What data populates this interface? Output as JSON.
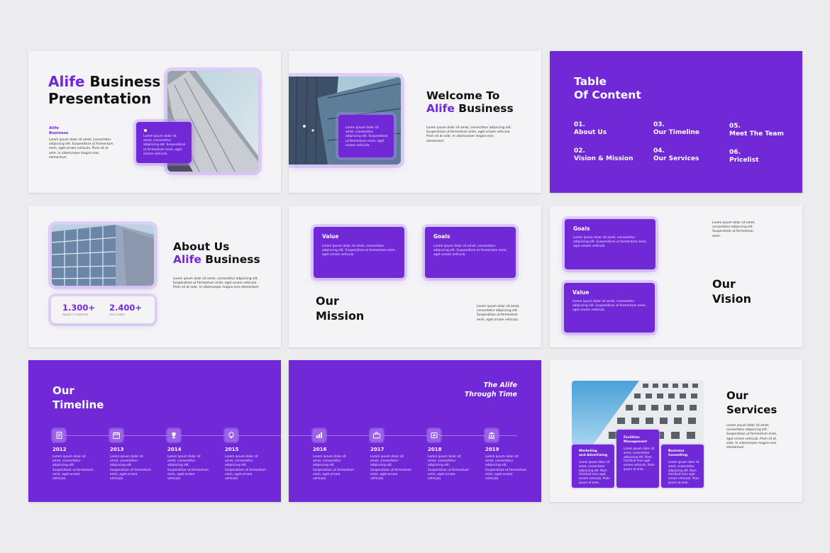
{
  "colors": {
    "accent": "#7129d8",
    "background": "#ececee",
    "slide_bg": "#f4f3f6"
  },
  "lorem": {
    "p1": "Lorem ipsum dolor sit amet, consectetur adipiscing elit. Suspendisse ut fermentum enim, eget ornare vehicula. Proin sit at ante. In ullamcorper magna eros elementum",
    "card": "Lorem ipsum dolor sit amet, consectetur adipiscing elit. Suspendisse ut fermentum enim, eget ornare vehicula.",
    "short": "Lorem ipsum dolor sit amet, consectetur adipiscing elit. Suspendisse ut fermentum enim.",
    "mission": "Lorem ipsum dolor sit amet, consectetur adipiscing elit. Suspendisse ut fermentum enim, eget ornare vehicula.",
    "vision": "Lorem ipsum dolor sit amet, consectetur adipiscing elit. Suspendisse ut fermentum enim.",
    "timeline": "Lorem ipsum dolor sit amet, consectetur adipiscing elit. Suspendisse ut fermentum enim, eget ornare vehicula.",
    "service": "Lorem ipsum dolor sit amet, consectetur adipiscing elit. Nam tincidunt eros eget ornare vehicula. Proin ipsum at ante."
  },
  "slide1": {
    "title_accent": "Alife",
    "title_rest": " Business",
    "title_line2": "Presentation",
    "sub_accent": "Alife",
    "sub_rest": "Business"
  },
  "slide2": {
    "line1": "Welcome To",
    "accent": "Alife",
    "rest": " Business"
  },
  "slide3": {
    "title_l1": "Table",
    "title_l2": "Of Content",
    "items": [
      {
        "num": "01.",
        "label": "About Us"
      },
      {
        "num": "02.",
        "label": "Vision & Mission"
      },
      {
        "num": "03.",
        "label": "Our Timeline"
      },
      {
        "num": "04.",
        "label": "Our Services"
      },
      {
        "num": "05.",
        "label": "Meet The Team"
      },
      {
        "num": "06.",
        "label": "Pricelist"
      }
    ]
  },
  "slide4": {
    "line1": "About Us",
    "accent": "Alife",
    "rest": " Business",
    "stat1": {
      "value": "1.300+",
      "label": "PROJECT COMPLETE"
    },
    "stat2": {
      "value": "2.400+",
      "label": "OUR CLIENT"
    }
  },
  "slide5": {
    "card1": "Value",
    "card2": "Goals",
    "title_l1": "Our",
    "title_l2": "Mission"
  },
  "slide6": {
    "card1": "Goals",
    "card2": "Value",
    "title_l1": "Our",
    "title_l2": "Vision"
  },
  "slide7": {
    "title_l1": "Our",
    "title_l2": "Timeline",
    "years": [
      "2012",
      "2013",
      "2014",
      "2015"
    ]
  },
  "slide8": {
    "title_l1": "The Alife",
    "title_l2": "Through Time",
    "years": [
      "2016",
      "2017",
      "2018",
      "2019"
    ]
  },
  "slide9": {
    "title_l1": "Our",
    "title_l2": "Services",
    "services": [
      {
        "l1": "Marketing",
        "l2": "and Advertising"
      },
      {
        "l1": "Facilities",
        "l2": "Management"
      },
      {
        "l1": "Business",
        "l2": "Consulting"
      }
    ]
  },
  "icons": [
    "document-icon",
    "calendar-icon",
    "trophy-icon",
    "lightbulb-icon",
    "chart-icon",
    "briefcase-icon",
    "target-icon",
    "bank-icon"
  ]
}
